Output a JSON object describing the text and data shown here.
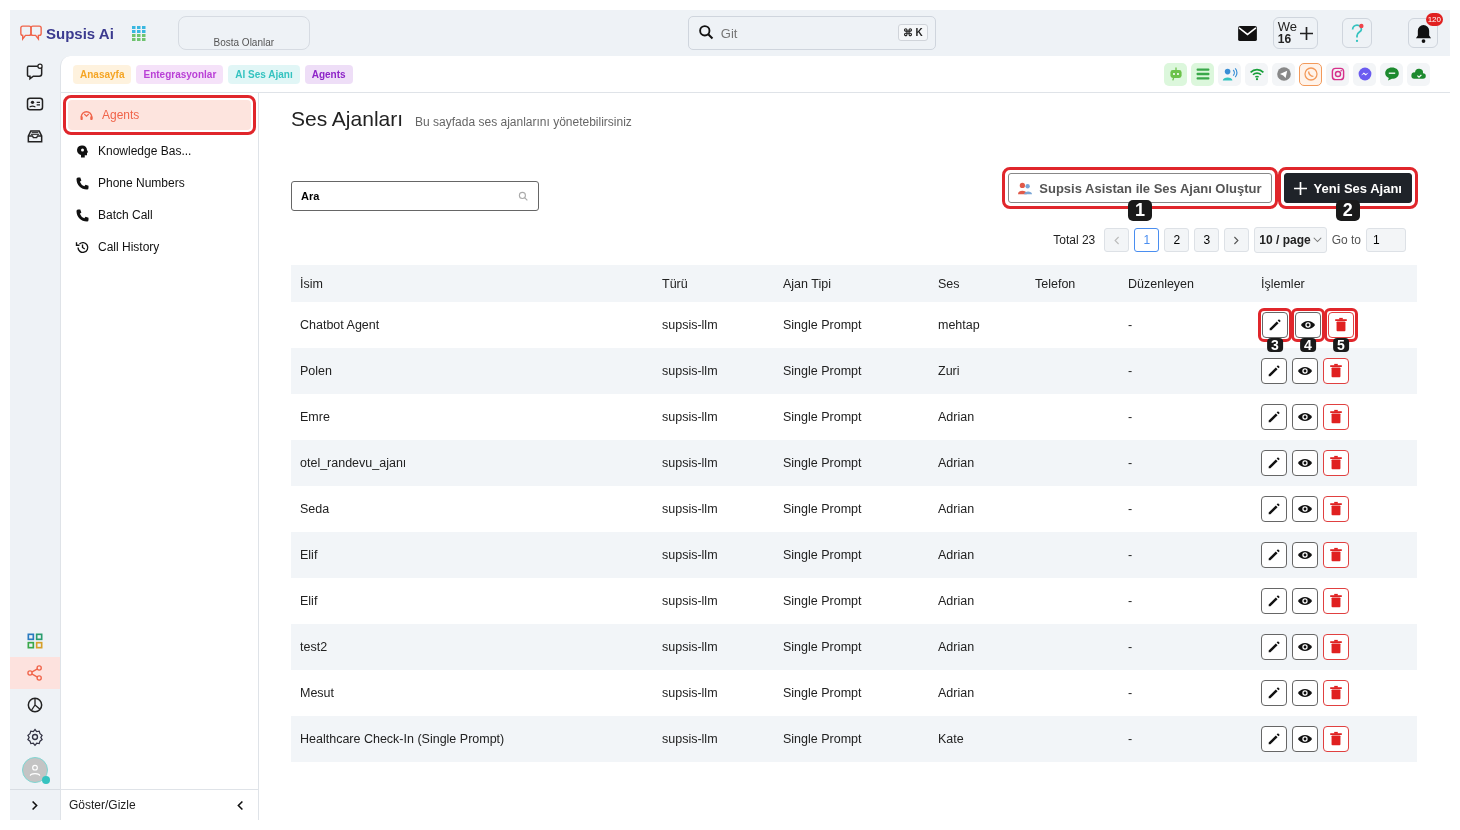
{
  "brand": {
    "name": "Supsis Ai"
  },
  "status_card": {
    "label": "Bosta Olanlar"
  },
  "search": {
    "placeholder": "Git",
    "shortcut": "⌘ K"
  },
  "user_badge": {
    "line_1": "We",
    "line_2": "16"
  },
  "notifications": {
    "count": "120"
  },
  "rail": {
    "top": [
      {
        "kind": "chat",
        "selected": false
      },
      {
        "kind": "contact",
        "selected": false
      },
      {
        "kind": "inbox",
        "selected": false
      }
    ],
    "bottom": [
      {
        "kind": "grid",
        "selected": false
      },
      {
        "kind": "share",
        "selected": true
      },
      {
        "kind": "chart",
        "selected": false
      },
      {
        "kind": "settings",
        "selected": false
      }
    ]
  },
  "breadcrumbs": [
    {
      "label": "Anasayfa",
      "color": "#f5a524"
    },
    {
      "label": "Entegrasyonlar",
      "color": "#b93fd6"
    },
    {
      "label": "AI Ses Ajanı",
      "color": "#35c3c0"
    },
    {
      "label": "Agents",
      "color": "#8e24c8"
    }
  ],
  "channels": [
    {
      "kind": "bot",
      "selected": false
    },
    {
      "kind": "list",
      "selected": false
    },
    {
      "kind": "voice",
      "selected": false
    },
    {
      "kind": "wifi",
      "selected": false
    },
    {
      "kind": "telegram",
      "selected": false
    },
    {
      "kind": "whatsapp",
      "selected": true
    },
    {
      "kind": "instagram",
      "selected": false
    },
    {
      "kind": "messenger",
      "selected": false
    },
    {
      "kind": "sms",
      "selected": false
    },
    {
      "kind": "cloud",
      "selected": false
    }
  ],
  "sidebar": {
    "items": [
      {
        "kind": "agent",
        "label": "Agents",
        "selected": true,
        "highlighted": true
      },
      {
        "kind": "brain",
        "label": "Knowledge Bas...",
        "selected": false,
        "highlighted": false
      },
      {
        "kind": "phone",
        "label": "Phone Numbers",
        "selected": false,
        "highlighted": false
      },
      {
        "kind": "phone",
        "label": "Batch Call",
        "selected": false,
        "highlighted": false
      },
      {
        "kind": "history",
        "label": "Call History",
        "selected": false,
        "highlighted": false
      }
    ],
    "footer": "Göster/Gizle"
  },
  "page": {
    "title": "Ses Ajanları",
    "subtitle": "Bu sayfada ses ajanlarını yönetebilirsiniz"
  },
  "filter": {
    "value": "Ara"
  },
  "actions": [
    {
      "kind": "assistant",
      "label": "Supsis Asistan ile Ses Ajanı Oluştur",
      "highlighted": true,
      "marker": "1"
    },
    {
      "kind": "create",
      "label": "Yeni Ses Ajanı",
      "highlighted": true,
      "marker": "2"
    }
  ],
  "pagination": {
    "total": "Total 23",
    "pages": [
      {
        "label": "1",
        "selected": true
      },
      {
        "label": "2",
        "selected": false
      },
      {
        "label": "3",
        "selected": false
      }
    ],
    "page_size": "10 / page",
    "goto_label": "Go to",
    "goto_value": "1"
  },
  "table": {
    "columns": [
      "İsim",
      "Türü",
      "Ajan Tipi",
      "Ses",
      "Telefon",
      "Düzenleyen",
      "İşlemler"
    ],
    "action_markers": [
      "3",
      "4",
      "5"
    ],
    "rows": [
      {
        "name": "Chatbot Agent",
        "type": "supsis-llm",
        "agent_type": "Single Prompt",
        "voice": "mehtap",
        "editor": "-",
        "annotated": true
      },
      {
        "name": "Polen",
        "type": "supsis-llm",
        "agent_type": "Single Prompt",
        "voice": "Zuri",
        "editor": "-",
        "annotated": false
      },
      {
        "name": "Emre",
        "type": "supsis-llm",
        "agent_type": "Single Prompt",
        "voice": "Adrian",
        "editor": "-",
        "annotated": false
      },
      {
        "name": "otel_randevu_ajanı",
        "type": "supsis-llm",
        "agent_type": "Single Prompt",
        "voice": "Adrian",
        "editor": "-",
        "annotated": false
      },
      {
        "name": "Seda",
        "type": "supsis-llm",
        "agent_type": "Single Prompt",
        "voice": "Adrian",
        "editor": "-",
        "annotated": false
      },
      {
        "name": "Elif",
        "type": "supsis-llm",
        "agent_type": "Single Prompt",
        "voice": "Adrian",
        "editor": "-",
        "annotated": false
      },
      {
        "name": "Elif",
        "type": "supsis-llm",
        "agent_type": "Single Prompt",
        "voice": "Adrian",
        "editor": "-",
        "annotated": false
      },
      {
        "name": "test2",
        "type": "supsis-llm",
        "agent_type": "Single Prompt",
        "voice": "Adrian",
        "editor": "-",
        "annotated": false
      },
      {
        "name": "Mesut",
        "type": "supsis-llm",
        "agent_type": "Single Prompt",
        "voice": "Adrian",
        "editor": "-",
        "annotated": false
      },
      {
        "name": "Healthcare Check-In (Single Prompt)",
        "type": "supsis-llm",
        "agent_type": "Single Prompt",
        "voice": "Kate",
        "editor": "-",
        "annotated": false
      }
    ]
  }
}
